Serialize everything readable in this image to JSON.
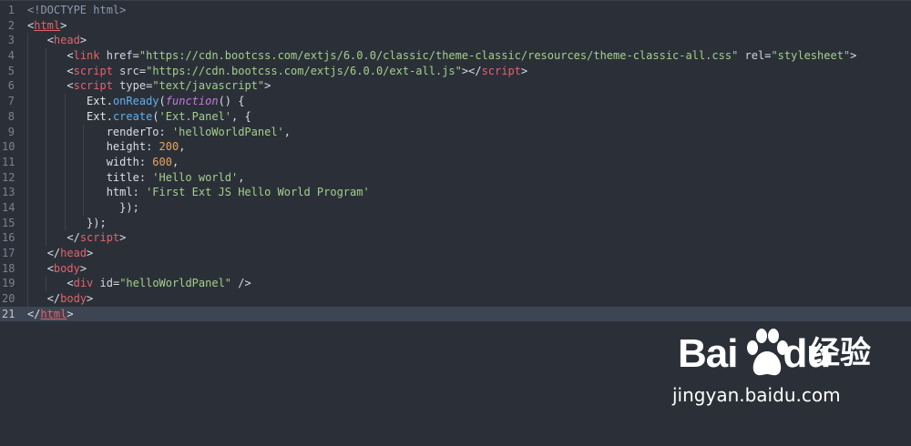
{
  "editor": {
    "line_numbers": [
      "1",
      "2",
      "3",
      "4",
      "5",
      "6",
      "7",
      "8",
      "9",
      "10",
      "11",
      "12",
      "13",
      "14",
      "15",
      "16",
      "17",
      "18",
      "19",
      "20",
      "21"
    ],
    "active_line": 21,
    "colors": {
      "background": "#2b3038",
      "active_line_bg": "#3e4552",
      "tag": "#e2626b",
      "string": "#a3cf8c",
      "number": "#e9a55d",
      "keyword": "#c678dd",
      "function": "#61afef"
    },
    "lines": [
      [
        {
          "t": "doctype",
          "v": "<!DOCTYPE html>"
        }
      ],
      [
        {
          "t": "punc",
          "v": "<"
        },
        {
          "t": "tag",
          "v": "html"
        },
        {
          "t": "punc",
          "v": ">"
        }
      ],
      [
        {
          "t": "punc",
          "v": "<"
        },
        {
          "t": "tag",
          "v": "head"
        },
        {
          "t": "punc",
          "v": ">"
        }
      ],
      [
        {
          "t": "punc",
          "v": "<"
        },
        {
          "t": "tag",
          "v": "link"
        },
        {
          "t": "attr",
          "v": " href"
        },
        {
          "t": "punc",
          "v": "="
        },
        {
          "t": "str",
          "v": "\"https://cdn.bootcss.com/extjs/6.0.0/classic/theme-classic/resources/theme-classic-all.css\""
        },
        {
          "t": "attr",
          "v": " rel"
        },
        {
          "t": "punc",
          "v": "="
        },
        {
          "t": "str",
          "v": "\"stylesheet\""
        },
        {
          "t": "punc",
          "v": ">"
        }
      ],
      [
        {
          "t": "punc",
          "v": "<"
        },
        {
          "t": "tag",
          "v": "script"
        },
        {
          "t": "attr",
          "v": " src"
        },
        {
          "t": "punc",
          "v": "="
        },
        {
          "t": "str",
          "v": "\"https://cdn.bootcss.com/extjs/6.0.0/ext-all.js\""
        },
        {
          "t": "punc",
          "v": "></"
        },
        {
          "t": "tag",
          "v": "script"
        },
        {
          "t": "punc",
          "v": ">"
        }
      ],
      [
        {
          "t": "punc",
          "v": "<"
        },
        {
          "t": "tag",
          "v": "script"
        },
        {
          "t": "attr",
          "v": " type"
        },
        {
          "t": "punc",
          "v": "="
        },
        {
          "t": "str",
          "v": "\"text/javascript\""
        },
        {
          "t": "punc",
          "v": ">"
        }
      ],
      [
        {
          "t": "id",
          "v": "Ext"
        },
        {
          "t": "punc",
          "v": "."
        },
        {
          "t": "fn",
          "v": "onReady"
        },
        {
          "t": "punc",
          "v": "("
        },
        {
          "t": "kw",
          "v": "function"
        },
        {
          "t": "punc",
          "v": "() {"
        }
      ],
      [
        {
          "t": "id",
          "v": "Ext"
        },
        {
          "t": "punc",
          "v": "."
        },
        {
          "t": "fn",
          "v": "create"
        },
        {
          "t": "punc",
          "v": "("
        },
        {
          "t": "str",
          "v": "'Ext.Panel'"
        },
        {
          "t": "punc",
          "v": ", {"
        }
      ],
      [
        {
          "t": "prop",
          "v": "renderTo"
        },
        {
          "t": "punc",
          "v": ": "
        },
        {
          "t": "str",
          "v": "'helloWorldPanel'"
        },
        {
          "t": "punc",
          "v": ","
        }
      ],
      [
        {
          "t": "prop",
          "v": "height"
        },
        {
          "t": "punc",
          "v": ": "
        },
        {
          "t": "num",
          "v": "200"
        },
        {
          "t": "punc",
          "v": ","
        }
      ],
      [
        {
          "t": "prop",
          "v": "width"
        },
        {
          "t": "punc",
          "v": ": "
        },
        {
          "t": "num",
          "v": "600"
        },
        {
          "t": "punc",
          "v": ","
        }
      ],
      [
        {
          "t": "prop",
          "v": "title"
        },
        {
          "t": "punc",
          "v": ": "
        },
        {
          "t": "str",
          "v": "'Hello world'"
        },
        {
          "t": "punc",
          "v": ","
        }
      ],
      [
        {
          "t": "prop",
          "v": "html"
        },
        {
          "t": "punc",
          "v": ": "
        },
        {
          "t": "str",
          "v": "'First Ext JS Hello World Program'"
        }
      ],
      [
        {
          "t": "punc",
          "v": "});"
        }
      ],
      [
        {
          "t": "punc",
          "v": "});"
        }
      ],
      [
        {
          "t": "punc",
          "v": "</"
        },
        {
          "t": "tag",
          "v": "script"
        },
        {
          "t": "punc",
          "v": ">"
        }
      ],
      [
        {
          "t": "punc",
          "v": "</"
        },
        {
          "t": "tag",
          "v": "head"
        },
        {
          "t": "punc",
          "v": ">"
        }
      ],
      [
        {
          "t": "punc",
          "v": "<"
        },
        {
          "t": "tag",
          "v": "body"
        },
        {
          "t": "punc",
          "v": ">"
        }
      ],
      [
        {
          "t": "punc",
          "v": "<"
        },
        {
          "t": "tag",
          "v": "div"
        },
        {
          "t": "attr",
          "v": " id"
        },
        {
          "t": "punc",
          "v": "="
        },
        {
          "t": "str",
          "v": "\"helloWorldPanel\""
        },
        {
          "t": "punc",
          "v": " />"
        }
      ],
      [
        {
          "t": "punc",
          "v": "</"
        },
        {
          "t": "tag",
          "v": "body"
        },
        {
          "t": "punc",
          "v": ">"
        }
      ],
      [
        {
          "t": "punc",
          "v": "</"
        },
        {
          "t": "tag",
          "v": "html"
        },
        {
          "t": "punc",
          "v": ">"
        }
      ]
    ]
  },
  "watermark": {
    "logo_text": "Bai du",
    "logo_cn": "经验",
    "url": "jingyan.baidu.com"
  }
}
